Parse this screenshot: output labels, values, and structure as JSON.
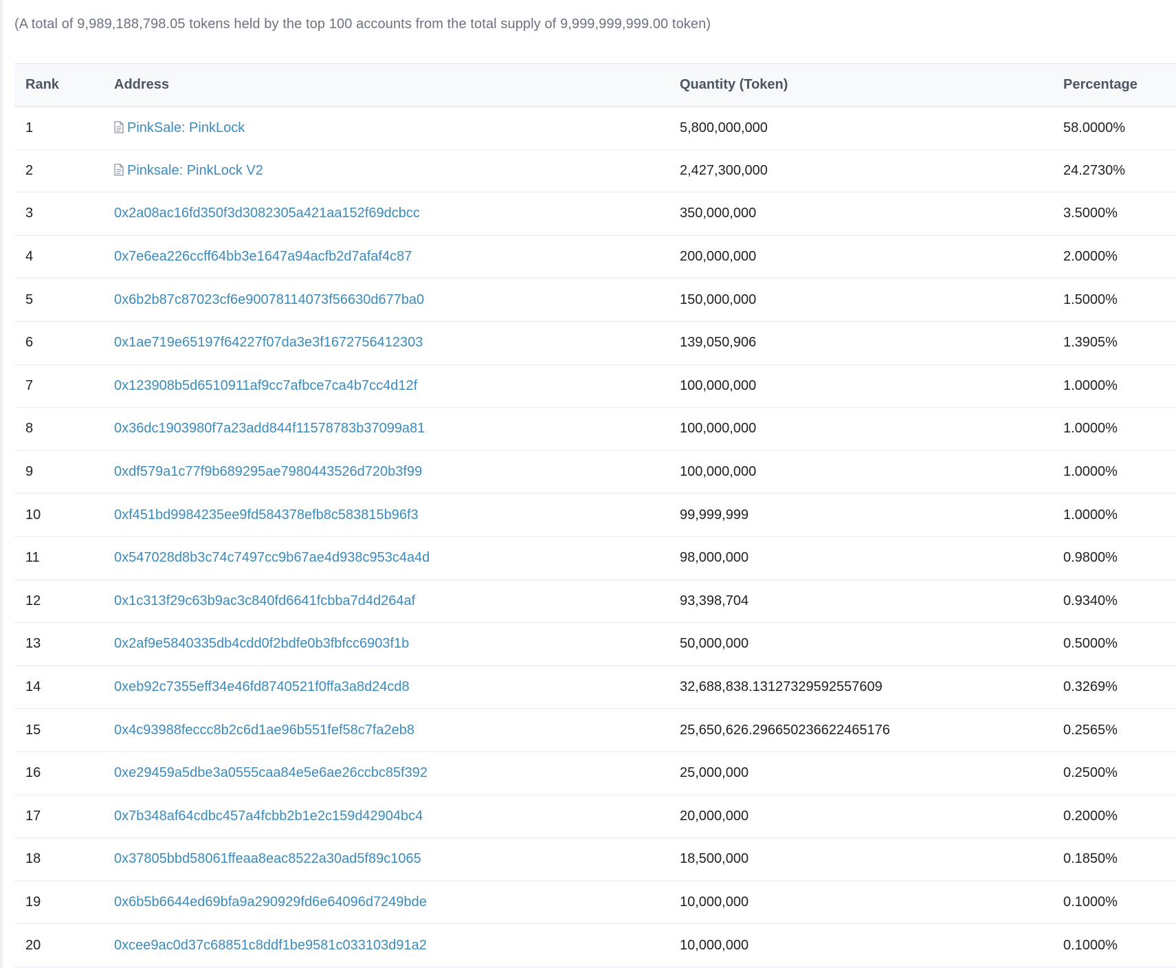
{
  "summary": "(A total of 9,989,188,798.05 tokens held by the top 100 accounts from the total supply of 9,999,999,999.00 token)",
  "table": {
    "headers": {
      "rank": "Rank",
      "address": "Address",
      "quantity": "Quantity (Token)",
      "percentage": "Percentage"
    },
    "rows": [
      {
        "rank": "1",
        "address": "PinkSale: PinkLock",
        "icon": "contract-icon",
        "quantity": "5,800,000,000",
        "percentage": "58.0000%"
      },
      {
        "rank": "2",
        "address": "Pinksale: PinkLock V2",
        "icon": "contract-icon",
        "quantity": "2,427,300,000",
        "percentage": "24.2730%"
      },
      {
        "rank": "3",
        "address": "0x2a08ac16fd350f3d3082305a421aa152f69dcbcc",
        "quantity": "350,000,000",
        "percentage": "3.5000%"
      },
      {
        "rank": "4",
        "address": "0x7e6ea226ccff64bb3e1647a94acfb2d7afaf4c87",
        "quantity": "200,000,000",
        "percentage": "2.0000%"
      },
      {
        "rank": "5",
        "address": "0x6b2b87c87023cf6e90078114073f56630d677ba0",
        "quantity": "150,000,000",
        "percentage": "1.5000%"
      },
      {
        "rank": "6",
        "address": "0x1ae719e65197f64227f07da3e3f1672756412303",
        "quantity": "139,050,906",
        "percentage": "1.3905%"
      },
      {
        "rank": "7",
        "address": "0x123908b5d6510911af9cc7afbce7ca4b7cc4d12f",
        "quantity": "100,000,000",
        "percentage": "1.0000%"
      },
      {
        "rank": "8",
        "address": "0x36dc1903980f7a23add844f11578783b37099a81",
        "quantity": "100,000,000",
        "percentage": "1.0000%"
      },
      {
        "rank": "9",
        "address": "0xdf579a1c77f9b689295ae7980443526d720b3f99",
        "quantity": "100,000,000",
        "percentage": "1.0000%"
      },
      {
        "rank": "10",
        "address": "0xf451bd9984235ee9fd584378efb8c583815b96f3",
        "quantity": "99,999,999",
        "percentage": "1.0000%"
      },
      {
        "rank": "11",
        "address": "0x547028d8b3c74c7497cc9b67ae4d938c953c4a4d",
        "quantity": "98,000,000",
        "percentage": "0.9800%"
      },
      {
        "rank": "12",
        "address": "0x1c313f29c63b9ac3c840fd6641fcbba7d4d264af",
        "quantity": "93,398,704",
        "percentage": "0.9340%"
      },
      {
        "rank": "13",
        "address": "0x2af9e5840335db4cdd0f2bdfe0b3fbfcc6903f1b",
        "quantity": "50,000,000",
        "percentage": "0.5000%"
      },
      {
        "rank": "14",
        "address": "0xeb92c7355eff34e46fd8740521f0ffa3a8d24cd8",
        "quantity": "32,688,838.13127329592557609",
        "percentage": "0.3269%"
      },
      {
        "rank": "15",
        "address": "0x4c93988feccc8b2c6d1ae96b551fef58c7fa2eb8",
        "quantity": "25,650,626.296650236622465176",
        "percentage": "0.2565%"
      },
      {
        "rank": "16",
        "address": "0xe29459a5dbe3a0555caa84e5e6ae26ccbc85f392",
        "quantity": "25,000,000",
        "percentage": "0.2500%"
      },
      {
        "rank": "17",
        "address": "0x7b348af64cdbc457a4fcbb2b1e2c159d42904bc4",
        "quantity": "20,000,000",
        "percentage": "0.2000%"
      },
      {
        "rank": "18",
        "address": "0x37805bbd58061ffeaa8eac8522a30ad5f89c1065",
        "quantity": "18,500,000",
        "percentage": "0.1850%"
      },
      {
        "rank": "19",
        "address": "0x6b5b6644ed69bfa9a290929fd6e64096d7249bde",
        "quantity": "10,000,000",
        "percentage": "0.1000%"
      },
      {
        "rank": "20",
        "address": "0xcee9ac0d37c68851c8ddf1be9581c033103d91a2",
        "quantity": "10,000,000",
        "percentage": "0.1000%"
      }
    ]
  },
  "colors": {
    "link": "#3a8bbd",
    "text": "#1e2022",
    "muted": "#6b7280",
    "header_bg": "#f8f9fa",
    "border": "#e7eaf3"
  }
}
